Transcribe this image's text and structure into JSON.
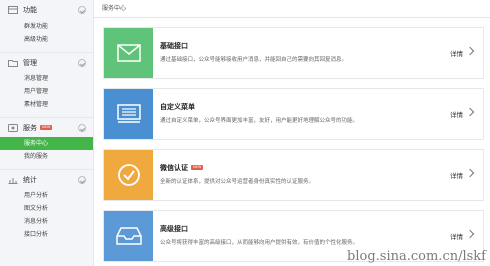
{
  "sidebar": {
    "sections": [
      {
        "title": "功能",
        "icon": "grid-icon",
        "items": [
          "群发功能",
          "高级功能"
        ]
      },
      {
        "title": "管理",
        "icon": "folder-icon",
        "items": [
          "消息管理",
          "用户管理",
          "素材管理"
        ]
      },
      {
        "title": "服务",
        "icon": "service-icon",
        "badge": "NEW",
        "items": [
          "服务中心",
          "我的服务"
        ],
        "active_index": 0
      },
      {
        "title": "统计",
        "icon": "chart-icon",
        "items": [
          "用户分析",
          "图文分析",
          "消息分析",
          "接口分析"
        ]
      }
    ]
  },
  "main": {
    "page_title": "服务中心",
    "cards": [
      {
        "title": "基础接口",
        "desc": "通过基础接口，公众号能够接收用户消息，并能回自己的需要向其回复消息。",
        "detail": "详情",
        "color": "#5fc479",
        "icon": "mail-icon"
      },
      {
        "title": "自定义菜单",
        "desc": "通过自定义菜单，公众号界面更加丰富，友好，用户能更好地理解公众号的功能。",
        "detail": "详情",
        "color": "#4b8fd3",
        "icon": "menu-icon"
      },
      {
        "title": "微信认证",
        "badge": "NEW",
        "desc": "全新的认证体系，提供对公众号运营者身份真实性的认证服务。",
        "detail": "详情",
        "color": "#f0a93f",
        "icon": "check-icon"
      },
      {
        "title": "高级接口",
        "desc": "公众号将获得丰富的高级接口，从而能够向用户提供有效，有价值的个性化服务。",
        "detail": "详情",
        "color": "#5b9ad6",
        "icon": "inbox-icon"
      }
    ]
  },
  "watermark": "blog.sina.com.cn/lskf",
  "colors": {
    "accent_green": "#44b549",
    "new_badge": "#e15f49"
  }
}
